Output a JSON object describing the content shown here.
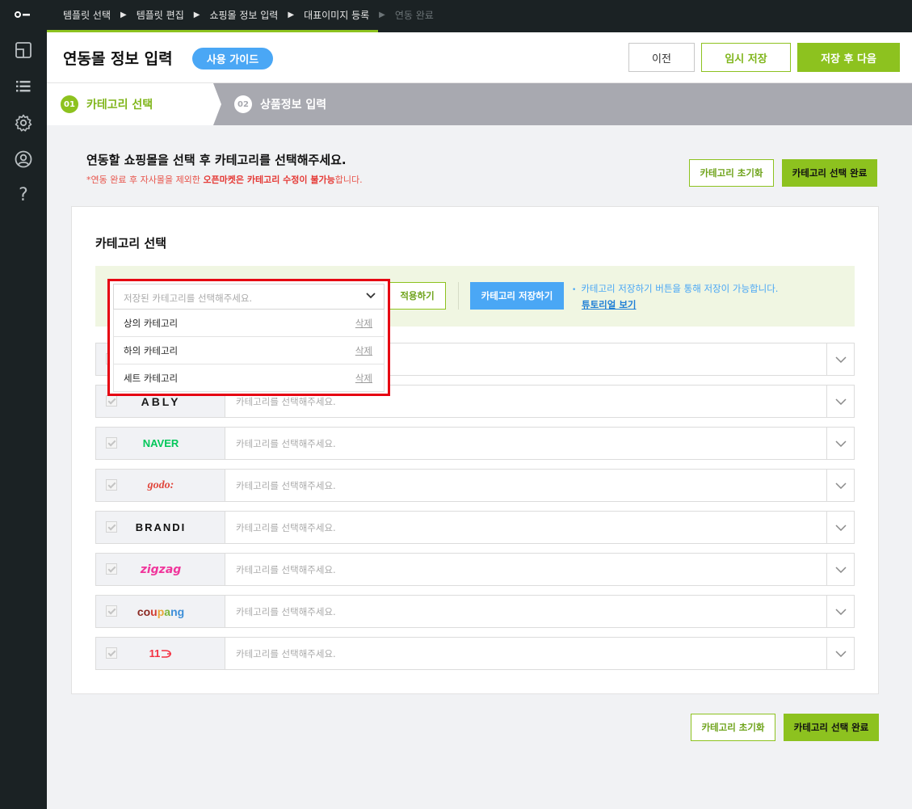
{
  "breadcrumb": {
    "items": [
      {
        "label": "템플릿 선택",
        "state": "done"
      },
      {
        "label": "템플릿 편집",
        "state": "done"
      },
      {
        "label": "쇼핑몰 정보 입력",
        "state": "done"
      },
      {
        "label": "대표이미지 등록",
        "state": "current"
      },
      {
        "label": "연동 완료",
        "state": "disabled"
      }
    ]
  },
  "sidebar": {
    "icons": [
      "logo-icon",
      "layout-icon",
      "list-icon",
      "gear-icon",
      "user-icon",
      "help-icon"
    ],
    "help_glyph": "?"
  },
  "header": {
    "title": "연동몰 정보 입력",
    "guide_label": "사용 가이드",
    "prev_label": "이전",
    "temp_save_label": "임시 저장",
    "save_next_label": "저장 후 다음"
  },
  "steps": [
    {
      "num": "01",
      "label": "카테고리 선택",
      "active": true
    },
    {
      "num": "02",
      "label": "상품정보 입력",
      "active": false
    }
  ],
  "intro": {
    "title": "연동할 쇼핑몰을 선택 후 카테고리를 선택해주세요.",
    "note_prefix": "*연동 완료 후 자사몰을 제외한 ",
    "note_bold": "오픈마켓은 카테고리 수정이 불가능",
    "note_suffix": "합니다."
  },
  "actions": {
    "reset_label": "카테고리 초기화",
    "complete_label": "카테고리 선택 완료"
  },
  "panel": {
    "title": "카테고리 선택",
    "saved_select": {
      "placeholder": "저장된 카테고리를 선택해주세요.",
      "options": [
        {
          "name": "상의 카테고리",
          "delete_label": "삭제"
        },
        {
          "name": "하의 카테고리",
          "delete_label": "삭제"
        },
        {
          "name": "세트 카테고리",
          "delete_label": "삭제"
        }
      ]
    },
    "apply_label": "적용하기",
    "save_category_label": "카테고리 저장하기",
    "hint_text": "카테고리 저장하기 버튼을 통해 저장이 가능합니다.",
    "hint_dot": "•",
    "tutorial_label": "튜토리얼 보기",
    "row_placeholder": "카테고리를 선택해주세요.",
    "malls": [
      {
        "name": "",
        "logo": ""
      },
      {
        "name": "ably",
        "logo": "ABLY"
      },
      {
        "name": "naver",
        "logo": "NAVER"
      },
      {
        "name": "godo",
        "logo": "godo:"
      },
      {
        "name": "brandi",
        "logo": "BRANDI"
      },
      {
        "name": "zigzag",
        "logo": "zigzag"
      },
      {
        "name": "coupang",
        "logo": "coupang"
      },
      {
        "name": "11st",
        "logo": "11"
      }
    ]
  },
  "colors": {
    "accent_green": "#8dc21f",
    "accent_blue": "#4aa7f5",
    "highlight_red": "#e60012",
    "sidebar_dark": "#1b2224"
  }
}
